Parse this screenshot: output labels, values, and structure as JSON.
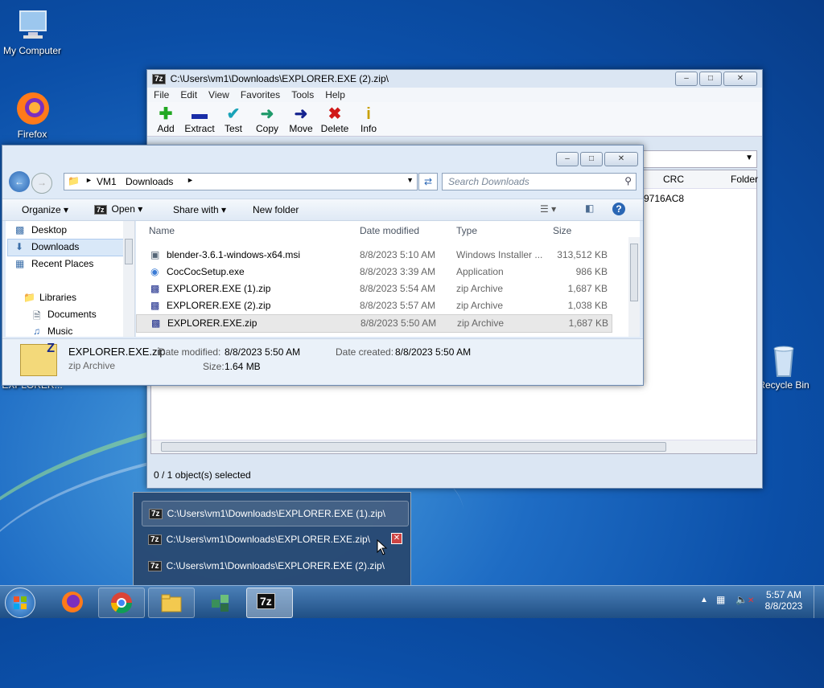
{
  "desktop": {
    "icons": [
      {
        "label": "My Computer"
      },
      {
        "label": "Firefox"
      },
      {
        "label": "EXPLORER..."
      },
      {
        "label": "Recycle Bin"
      }
    ]
  },
  "sevenzip": {
    "title": "C:\\Users\\vm1\\Downloads\\EXPLORER.EXE (2).zip\\",
    "menu": [
      "File",
      "Edit",
      "View",
      "Favorites",
      "Tools",
      "Help"
    ],
    "toolbar": [
      {
        "label": "Add",
        "icon": "plus-icon",
        "color": "#22a822"
      },
      {
        "label": "Extract",
        "icon": "minus-icon",
        "color": "#1a2ea8"
      },
      {
        "label": "Test",
        "icon": "check-icon",
        "color": "#1aa3b8"
      },
      {
        "label": "Copy",
        "icon": "arrow-right-icon",
        "color": "#1f9a6a"
      },
      {
        "label": "Move",
        "icon": "arrow-right-icon",
        "color": "#15238f"
      },
      {
        "label": "Delete",
        "icon": "x-icon",
        "color": "#d01818"
      },
      {
        "label": "Info",
        "icon": "info-icon",
        "color": "#c8a000"
      }
    ],
    "columns": {
      "crc": "CRC",
      "folder": "Folder"
    },
    "crc_value": "9716AC8",
    "status": "0 / 1 object(s) selected"
  },
  "explorer": {
    "breadcrumb": [
      "VM1",
      "Downloads"
    ],
    "search_placeholder": "Search Downloads",
    "commands": {
      "organize": "Organize",
      "open": "Open",
      "share": "Share with",
      "new_folder": "New folder"
    },
    "nav": {
      "desktop": "Desktop",
      "downloads": "Downloads",
      "recent": "Recent Places",
      "libraries": "Libraries",
      "documents": "Documents",
      "music": "Music"
    },
    "columns": {
      "name": "Name",
      "date": "Date modified",
      "type": "Type",
      "size": "Size"
    },
    "files": [
      {
        "name": "blender-3.6.1-windows-x64.msi",
        "date": "8/8/2023 5:10 AM",
        "type": "Windows Installer ...",
        "size": "313,512 KB"
      },
      {
        "name": "CocCocSetup.exe",
        "date": "8/8/2023 3:39 AM",
        "type": "Application",
        "size": "986 KB"
      },
      {
        "name": "EXPLORER.EXE (1).zip",
        "date": "8/8/2023 5:54 AM",
        "type": "zip Archive",
        "size": "1,687 KB"
      },
      {
        "name": "EXPLORER.EXE (2).zip",
        "date": "8/8/2023 5:57 AM",
        "type": "zip Archive",
        "size": "1,038 KB"
      },
      {
        "name": "EXPLORER.EXE.zip",
        "date": "8/8/2023 5:50 AM",
        "type": "zip Archive",
        "size": "1,687 KB"
      }
    ],
    "details": {
      "name": "EXPLORER.EXE.zip",
      "type": "zip Archive",
      "modified_label": "Date modified:",
      "modified": "8/8/2023 5:50 AM",
      "created_label": "Date created:",
      "created": "8/8/2023 5:50 AM",
      "size_label": "Size:",
      "size": "1.64 MB"
    }
  },
  "jumplist": {
    "items": [
      "C:\\Users\\vm1\\Downloads\\EXPLORER.EXE (1).zip\\",
      "C:\\Users\\vm1\\Downloads\\EXPLORER.EXE.zip\\",
      "C:\\Users\\vm1\\Downloads\\EXPLORER.EXE (2).zip\\"
    ]
  },
  "taskbar": {
    "time": "5:57 AM",
    "date": "8/8/2023",
    "sevenzip_label": "7z"
  }
}
